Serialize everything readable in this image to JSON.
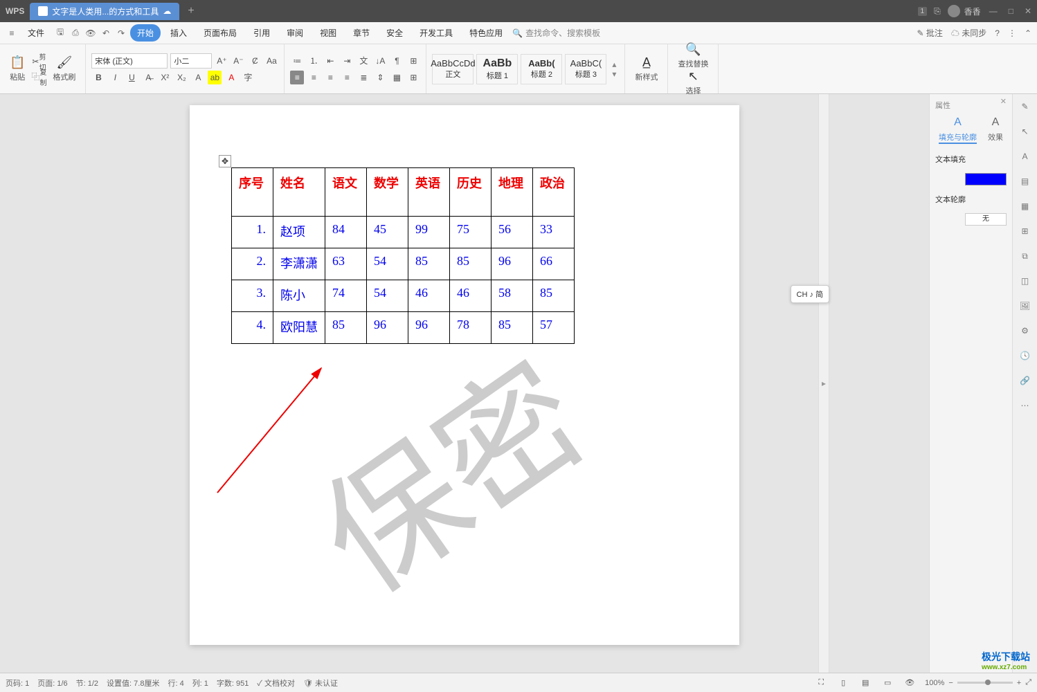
{
  "title": {
    "app": "WPS",
    "doc_tab": "文字是人类用...的方式和工具",
    "new_tab": "+",
    "user": "香香",
    "badge_num": "1"
  },
  "menubar": {
    "file": "文件",
    "tabs": [
      "开始",
      "插入",
      "页面布局",
      "引用",
      "审阅",
      "视图",
      "章节",
      "安全",
      "开发工具",
      "特色应用"
    ],
    "search_label": "查找命令、搜索模板",
    "annotate": "批注",
    "sync": "未同步"
  },
  "ribbon": {
    "clipboard": {
      "paste": "粘贴",
      "cut": "剪切",
      "copy": "复制",
      "format": "格式刷"
    },
    "font": {
      "name": "宋体 (正文)",
      "size": "小二"
    },
    "styles": {
      "s1": {
        "preview": "AaBbCcDd",
        "name": "正文"
      },
      "s2": {
        "preview": "AaBb",
        "name": "标题 1"
      },
      "s3": {
        "preview": "AaBb(",
        "name": "标题 2"
      },
      "s4": {
        "preview": "AaBbC(",
        "name": "标题 3"
      }
    },
    "newstyle": "新样式",
    "findreplace": "查找替换",
    "select": "选择"
  },
  "chart_data": {
    "type": "table",
    "headers": [
      "序号",
      "姓名",
      "语文",
      "数学",
      "英语",
      "历史",
      "地理",
      "政治"
    ],
    "rows": [
      [
        "1.",
        "赵项",
        "84",
        "45",
        "99",
        "75",
        "56",
        "33"
      ],
      [
        "2.",
        "李潇潇",
        "63",
        "54",
        "85",
        "85",
        "96",
        "66"
      ],
      [
        "3.",
        "陈小",
        "74",
        "54",
        "46",
        "46",
        "58",
        "85"
      ],
      [
        "4.",
        "欧阳慧",
        "85",
        "96",
        "96",
        "78",
        "85",
        "57"
      ]
    ]
  },
  "watermark": "保密",
  "ime": "CH ♪ 简",
  "properties": {
    "title": "属性",
    "tab1": "填充与轮廓",
    "tab2": "效果",
    "fill": "文本填充",
    "fill_color": "#0000ff",
    "outline": "文本轮廓",
    "outline_val": "无"
  },
  "statusbar": {
    "page_num": "页码: 1",
    "page": "页面: 1/6",
    "section": "节: 1/2",
    "pos": "设置值: 7.8厘米",
    "line": "行: 4",
    "col": "列: 1",
    "words": "字数: 951",
    "proof": "文档校对",
    "cert": "未认证",
    "zoom": "100%"
  },
  "site": {
    "l1": "极光下载站",
    "l2": "www.xz7.com"
  }
}
